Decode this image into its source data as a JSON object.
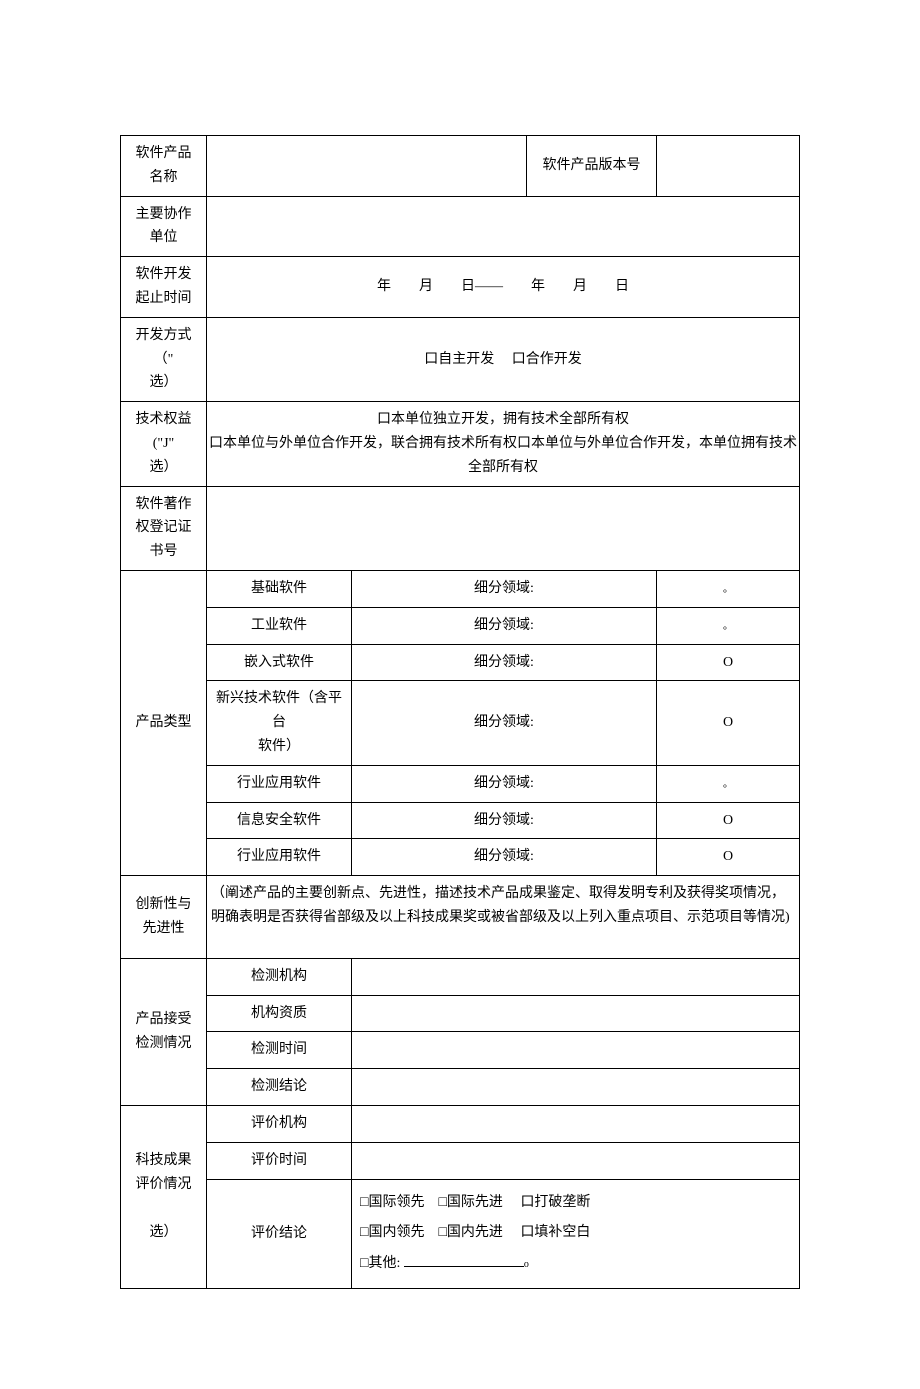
{
  "rows": {
    "product_name_label": "软件产品\n名称",
    "version_label": "软件产品版本号",
    "coop_unit_label": "主要协作\n单位",
    "dev_period_label": "软件开发\n起止时间",
    "dev_period_value": "年　　月　　日——　　年　　月　　日",
    "dev_mode_label": "开发方式\n（\"\n选）",
    "dev_mode_opt1": "口自主开发",
    "dev_mode_opt2": "口合作开发",
    "tech_rights_label": "技术权益\n(\"J\"\n选）",
    "tech_rights_opt1": "口本单位独立开发，拥有技术全部所有权",
    "tech_rights_opt2": "口本单位与外单位合作开发，联合拥有技术所有权口本单位与外单位合作开发，本单位拥有技术全部所有权",
    "copyright_label": "软件著作\n权登记证\n书号",
    "product_type_label": "产品类型",
    "product_types": [
      {
        "name": "基础软件",
        "sub": "细分领域:",
        "mark": "。"
      },
      {
        "name": "工业软件",
        "sub": "细分领域:",
        "mark": "。"
      },
      {
        "name": "嵌入式软件",
        "sub": "细分领域:",
        "mark": "O"
      },
      {
        "name": "新兴技术软件（含平台\n软件）",
        "sub": "细分领域:",
        "mark": "O"
      },
      {
        "name": "行业应用软件",
        "sub": "细分领域:",
        "mark": "。"
      },
      {
        "name": "信息安全软件",
        "sub": "细分领域:",
        "mark": "O"
      },
      {
        "name": "行业应用软件",
        "sub": "细分领域:",
        "mark": "O"
      }
    ],
    "innovation_label": "创新性与\n先进性",
    "innovation_text": "（阐述产品的主要创新点、先进性，描述技术产品成果鉴定、取得发明专利及获得奖项情况，明确表明是否获得省部级及以上科技成果奖或被省部级及以上列入重点项目、示范项目等情况)",
    "inspection_label": "产品接受\n检测情况",
    "inspection_rows": [
      "检测机构",
      "机构资质",
      "检测时间",
      "检测结论"
    ],
    "eval_label": "科技成果\n评价情况\n\n选）",
    "eval_org_label": "评价机构",
    "eval_time_label": "评价时间",
    "eval_result_label": "评价结论",
    "eval_opts": {
      "a1": "□国际领先",
      "a2": "□国际先进",
      "a3": "口打破垄断",
      "b1": "□国内领先",
      "b2": "□国内先进",
      "b3": "口填补空白",
      "other": "□其他:"
    }
  }
}
